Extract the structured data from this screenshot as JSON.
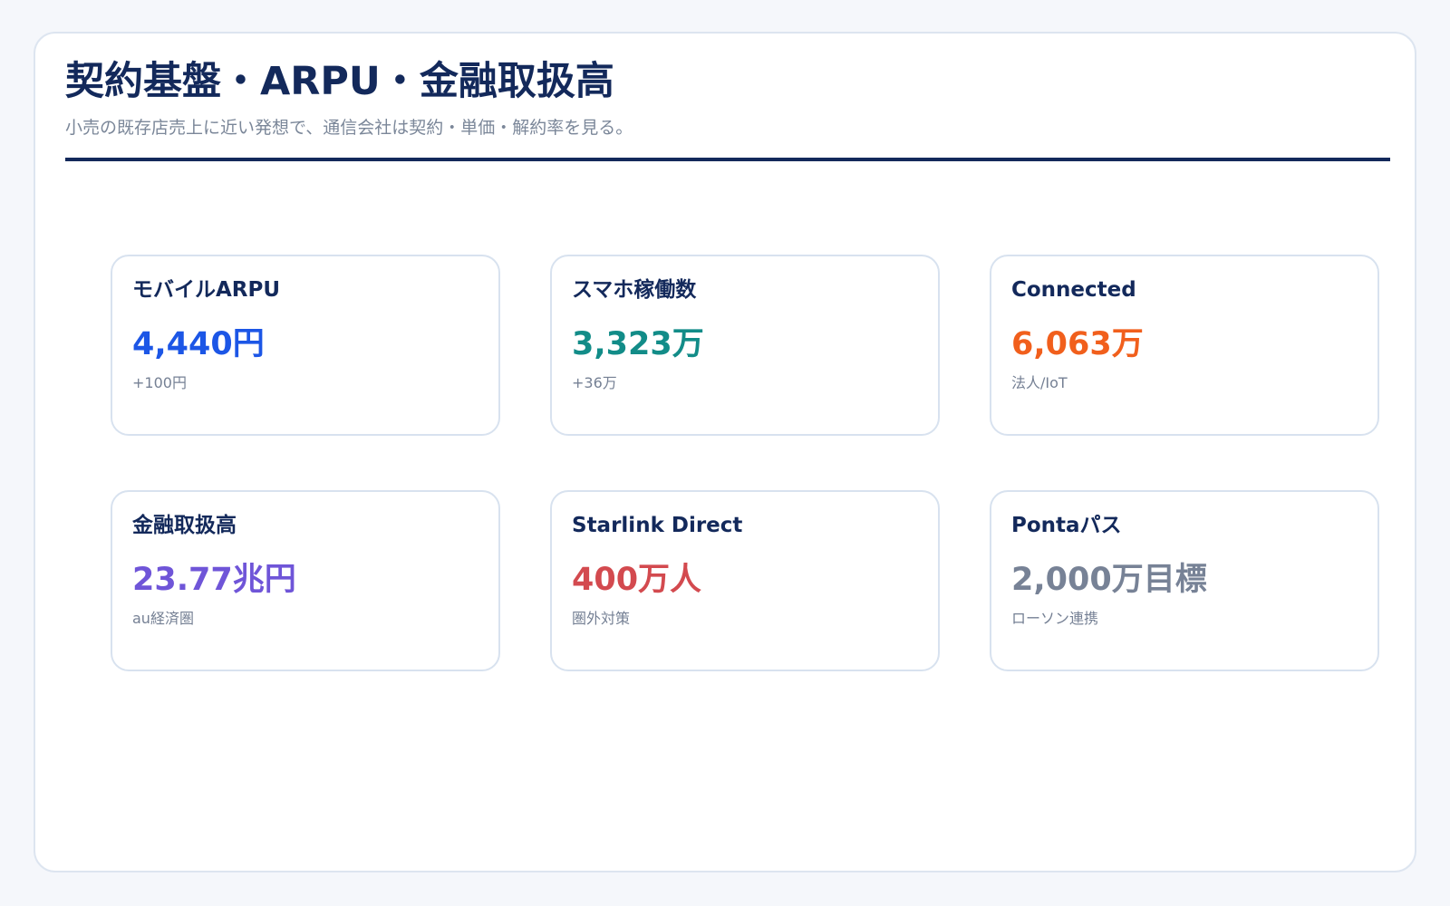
{
  "header": {
    "title": "契約基盤・ARPU・金融取扱高",
    "subtitle": "小売の既存店売上に近い発想で、通信会社は契約・単価・解約率を見る。"
  },
  "cards": [
    {
      "label": "モバイルARPU",
      "value": "4,440円",
      "note": "+100円",
      "color": "#1c56e6"
    },
    {
      "label": "スマホ稼働数",
      "value": "3,323万",
      "note": "+36万",
      "color": "#128c88"
    },
    {
      "label": "Connected",
      "value": "6,063万",
      "note": "法人/IoT",
      "color": "#f15f1c"
    },
    {
      "label": "金融取扱高",
      "value": "23.77兆円",
      "note": "au経済圏",
      "color": "#6f55d8"
    },
    {
      "label": "Starlink Direct",
      "value": "400万人",
      "note": "圏外対策",
      "color": "#d34a4f"
    },
    {
      "label": "Pontaパス",
      "value": "2,000万目標",
      "note": "ローソン連携",
      "color": "#778296"
    }
  ]
}
